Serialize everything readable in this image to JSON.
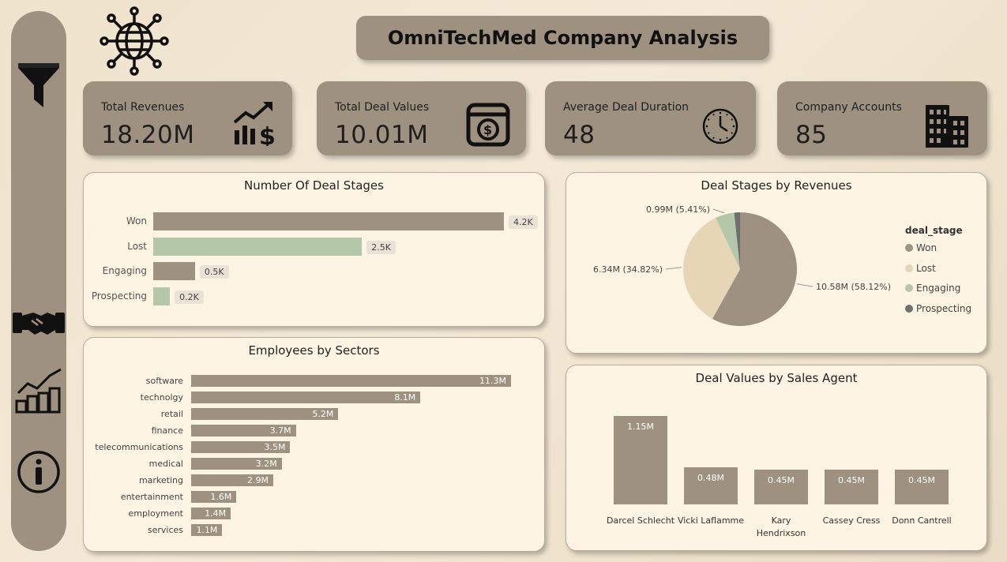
{
  "title": "OmniTechMed Company Analysis",
  "sidebar": {
    "items": [
      {
        "icon": "filter-icon"
      },
      {
        "icon": "handshake-icon"
      },
      {
        "icon": "growth-chart-icon"
      },
      {
        "icon": "info-icon"
      }
    ]
  },
  "kpis": [
    {
      "label": "Total Revenues",
      "value": "18.20M",
      "icon": "revenue-chart-icon"
    },
    {
      "label": "Total Deal Values",
      "value": "10.01M",
      "icon": "money-box-icon"
    },
    {
      "label": "Average Deal Duration",
      "value": "48",
      "icon": "clock-icon"
    },
    {
      "label": "Company Accounts",
      "value": "85",
      "icon": "building-icon"
    }
  ],
  "colors": {
    "primary": "#9e9180",
    "green": "#b5c7a9",
    "lost": "#e6d6b5",
    "prospecting": "#6f6f6f",
    "panel": "#fdf4e3"
  },
  "chart_data": [
    {
      "type": "bar",
      "title": "Number Of Deal Stages",
      "orientation": "horizontal",
      "categories": [
        "Won",
        "Lost",
        "Engaging",
        "Prospecting"
      ],
      "values": [
        4200,
        2500,
        500,
        200
      ],
      "labels": [
        "4.2K",
        "2.5K",
        "0.5K",
        "0.2K"
      ],
      "xlim": [
        0,
        4200
      ]
    },
    {
      "type": "pie",
      "title": "Deal Stages by Revenues",
      "legend_title": "deal_stage",
      "legend_position": "right",
      "categories": [
        "Won",
        "Lost",
        "Engaging",
        "Prospecting"
      ],
      "values": [
        10.58,
        6.34,
        0.99,
        0.3
      ],
      "labels": [
        "10.58M (58.12%)",
        "6.34M (34.82%)",
        "0.99M (5.41%)",
        ""
      ]
    },
    {
      "type": "bar",
      "title": "Employees by Sectors",
      "orientation": "horizontal",
      "categories": [
        "software",
        "technolgy",
        "retail",
        "finance",
        "telecommunications",
        "medical",
        "marketing",
        "entertainment",
        "employment",
        "services"
      ],
      "values": [
        11.3,
        8.1,
        5.2,
        3.7,
        3.5,
        3.2,
        2.9,
        1.6,
        1.4,
        1.1
      ],
      "labels": [
        "11.3M",
        "8.1M",
        "5.2M",
        "3.7M",
        "3.5M",
        "3.2M",
        "2.9M",
        "1.6M",
        "1.4M",
        "1.1M"
      ],
      "xlim": [
        0,
        11.3
      ]
    },
    {
      "type": "bar",
      "title": "Deal Values by Sales Agent",
      "categories": [
        "Darcel Schlecht",
        "Vicki Laflamme",
        "Kary Hendrixson",
        "Cassey Cress",
        "Donn Cantrell"
      ],
      "values": [
        1.15,
        0.48,
        0.45,
        0.45,
        0.45
      ],
      "labels": [
        "1.15M",
        "0.48M",
        "0.45M",
        "0.45M",
        "0.45M"
      ],
      "ylim": [
        0,
        1.15
      ]
    }
  ]
}
